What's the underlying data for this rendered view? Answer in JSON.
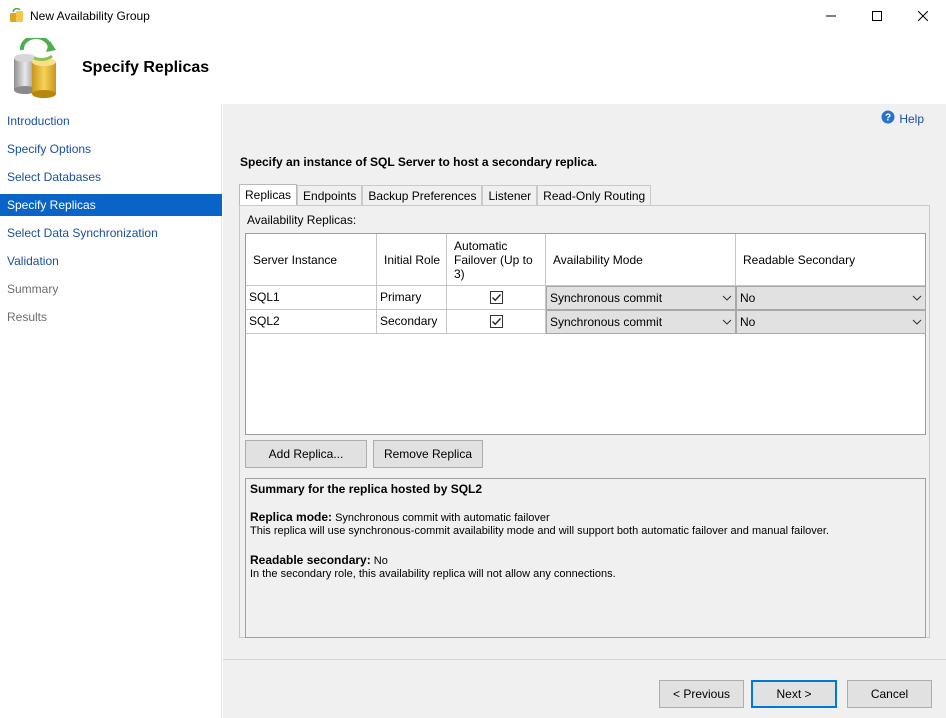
{
  "window": {
    "title": "New Availability Group",
    "minimize_glyph": "—",
    "maximize_glyph": "☐",
    "close_glyph": "✕"
  },
  "header": {
    "title": "Specify Replicas",
    "icon": "database-refresh-icon"
  },
  "nav": {
    "items": [
      {
        "label": "Introduction",
        "state": "link"
      },
      {
        "label": "Specify Options",
        "state": "link"
      },
      {
        "label": "Select Databases",
        "state": "link"
      },
      {
        "label": "Specify Replicas",
        "state": "selected"
      },
      {
        "label": "Select Data Synchronization",
        "state": "link"
      },
      {
        "label": "Validation",
        "state": "link"
      },
      {
        "label": "Summary",
        "state": "disabled"
      },
      {
        "label": "Results",
        "state": "disabled"
      }
    ]
  },
  "help": {
    "label": "Help",
    "icon": "help-icon"
  },
  "instruction": "Specify an instance of SQL Server to host a secondary replica.",
  "tabs": [
    {
      "label": "Replicas",
      "active": true
    },
    {
      "label": "Endpoints",
      "active": false
    },
    {
      "label": "Backup Preferences",
      "active": false
    },
    {
      "label": "Listener",
      "active": false
    },
    {
      "label": "Read-Only Routing",
      "active": false
    }
  ],
  "replicas": {
    "group_label": "Availability Replicas:",
    "columns": [
      "Server Instance",
      "Initial Role",
      "Automatic Failover (Up to 3)",
      "Availability Mode",
      "Readable Secondary"
    ],
    "rows": [
      {
        "server": "SQL1",
        "role": "Primary",
        "auto_failover": true,
        "mode": "Synchronous commit",
        "readable": "No"
      },
      {
        "server": "SQL2",
        "role": "Secondary",
        "auto_failover": true,
        "mode": "Synchronous commit",
        "readable": "No"
      }
    ]
  },
  "actions": {
    "add_replica": "Add Replica...",
    "remove_replica": "Remove Replica"
  },
  "summary": {
    "title": "Summary for the replica hosted by SQL2",
    "mode_label": "Replica mode:",
    "mode_value": "Synchronous commit with automatic failover",
    "mode_desc": "This replica will use synchronous-commit availability mode and will support both automatic failover and manual failover.",
    "readable_label": "Readable secondary:",
    "readable_value": "No",
    "readable_desc": "In the secondary role, this availability replica will not allow any connections."
  },
  "footer": {
    "previous": "< Previous",
    "next": "Next >",
    "cancel": "Cancel"
  },
  "colors": {
    "nav_selected": "#0a64c8",
    "link": "#1a4fa0",
    "panel_bg": "#f0f0f0"
  }
}
